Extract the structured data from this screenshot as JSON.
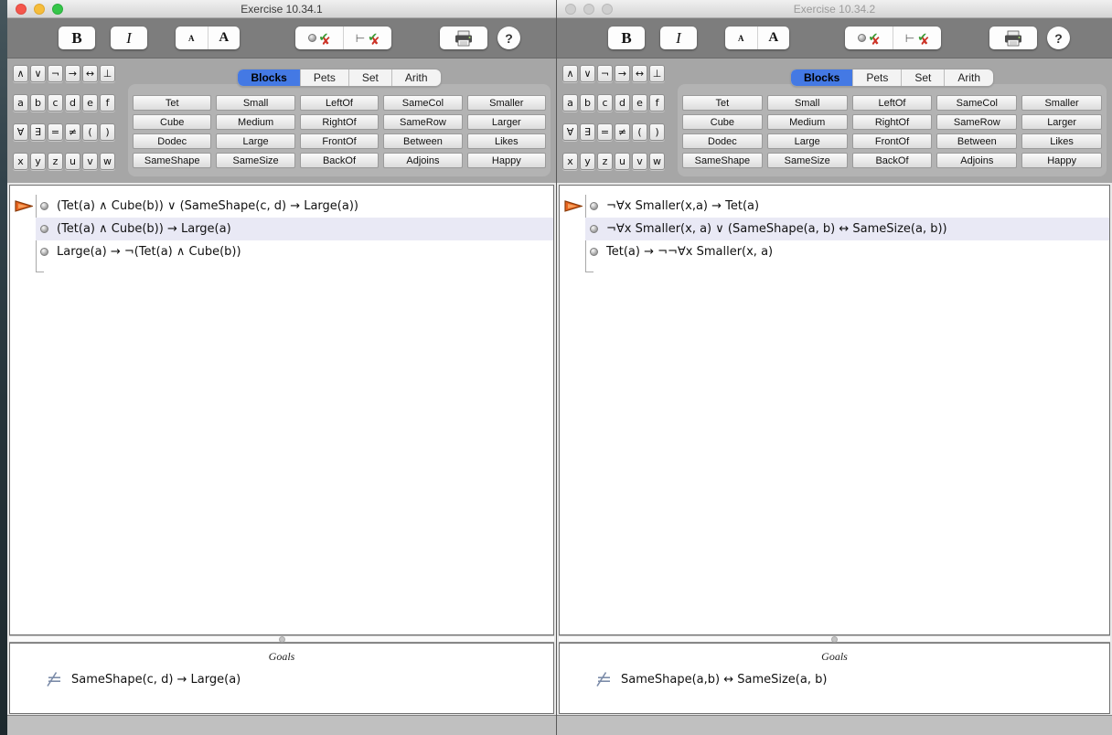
{
  "windows": [
    {
      "title": "Exercise 10.34.1",
      "active": true,
      "premises": [
        {
          "text": "(Tet(a) ∧ Cube(b)) ∨ (SameShape(c, d) → Large(a))",
          "focused": true,
          "highlighted": false
        },
        {
          "text": "(Tet(a) ∧ Cube(b)) → Large(a)",
          "focused": false,
          "highlighted": true
        },
        {
          "text": "Large(a) → ¬(Tet(a) ∧ Cube(b))",
          "focused": false,
          "highlighted": false
        }
      ],
      "goals_label": "Goals",
      "goal": "SameShape(c, d) → Large(a)"
    },
    {
      "title": "Exercise 10.34.2",
      "active": false,
      "premises": [
        {
          "text": "¬∀x Smaller(x,a) → Tet(a)",
          "focused": true,
          "highlighted": false
        },
        {
          "text": "¬∀x Smaller(x, a) ∨ (SameShape(a, b) ↔ SameSize(a, b))",
          "focused": false,
          "highlighted": true
        },
        {
          "text": "Tet(a) → ¬¬∀x Smaller(x, a)",
          "focused": false,
          "highlighted": false
        }
      ],
      "goals_label": "Goals",
      "goal": "SameShape(a,b) ↔ SameSize(a, b)"
    }
  ],
  "toolbar": {
    "bold_label": "B",
    "italic_label": "I",
    "font_small_label": "A",
    "font_large_label": "A",
    "check_step_icon": {
      "check": "✔",
      "cross": "✘"
    },
    "check_proof_icon": {
      "turnstile": "⊢",
      "check": "✔",
      "cross": "✘"
    },
    "printer_icon": "printer",
    "help_label": "?"
  },
  "palette_rows": [
    [
      "∧",
      "∨",
      "¬",
      "→",
      "↔",
      "⊥"
    ],
    [
      "a",
      "b",
      "c",
      "d",
      "e",
      "f"
    ],
    [
      "∀",
      "∃",
      "=",
      "≠",
      "(",
      ")"
    ],
    [
      "x",
      "y",
      "z",
      "u",
      "v",
      "w"
    ]
  ],
  "tabs": {
    "items": [
      "Blocks",
      "Pets",
      "Set",
      "Arith"
    ],
    "selected": "Blocks"
  },
  "predicates": [
    [
      "Tet",
      "Small",
      "LeftOf",
      "SameCol",
      "Smaller"
    ],
    [
      "Cube",
      "Medium",
      "RightOf",
      "SameRow",
      "Larger"
    ],
    [
      "Dodec",
      "Large",
      "FrontOf",
      "Between",
      "Likes"
    ],
    [
      "SameShape",
      "SameSize",
      "BackOf",
      "Adjoins",
      "Happy"
    ]
  ],
  "colors": {
    "selected_tab": "#4479e4",
    "row_highlight": "#e9e9f5",
    "focus_arrow": "#e8641f",
    "goal_icon": "#7b8ba8",
    "check_green": "#3a9b35",
    "cross_red": "#cc3326",
    "traffic_red": "#f5564c",
    "traffic_yellow": "#f6bd3b",
    "traffic_green": "#35c649",
    "toolbar_gray": "#7d7d7d",
    "panel_gray": "#a6a6a6"
  }
}
